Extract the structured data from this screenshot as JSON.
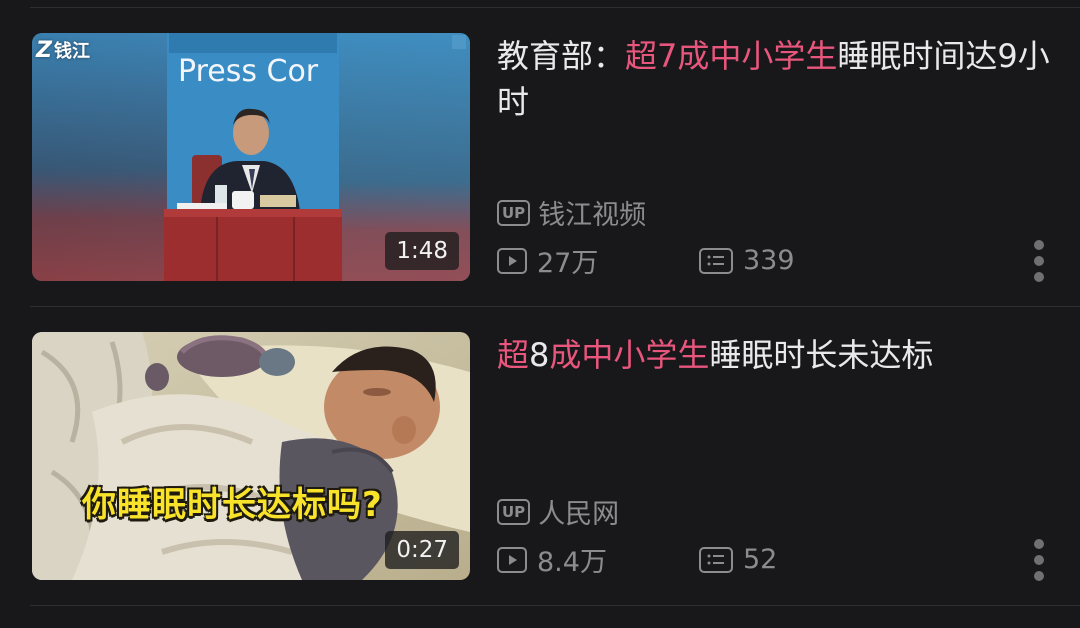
{
  "feed": {
    "items": [
      {
        "title_parts": [
          {
            "text": "教育部：",
            "highlight": false
          },
          {
            "text": "超7成中小学生",
            "highlight": true
          },
          {
            "text": "睡眠时间达9小时",
            "highlight": false
          }
        ],
        "uploader_badge": "UP",
        "uploader": "钱江视频",
        "views": "27万",
        "comments": "339",
        "duration": "1:48",
        "thumbnail": {
          "watermark": "钱江",
          "backdrop_text": "Press Cor"
        }
      },
      {
        "title_parts": [
          {
            "text": "超",
            "highlight": true
          },
          {
            "text": "8",
            "highlight": false
          },
          {
            "text": "成中小学生",
            "highlight": true
          },
          {
            "text": "睡眠时长未达标",
            "highlight": false
          }
        ],
        "uploader_badge": "UP",
        "uploader": "人民网",
        "views": "8.4万",
        "comments": "52",
        "duration": "0:27",
        "thumbnail": {
          "caption": "你睡眠时长达标吗?"
        }
      }
    ]
  },
  "colors": {
    "background": "#18181a",
    "title_text": "#e9e9eb",
    "highlight": "#e8567d",
    "meta_text": "#8c8c90"
  },
  "icons": {
    "uploader": "up-badge-icon",
    "views": "play-count-icon",
    "comments": "comment-count-icon",
    "more": "more-vertical-icon"
  }
}
